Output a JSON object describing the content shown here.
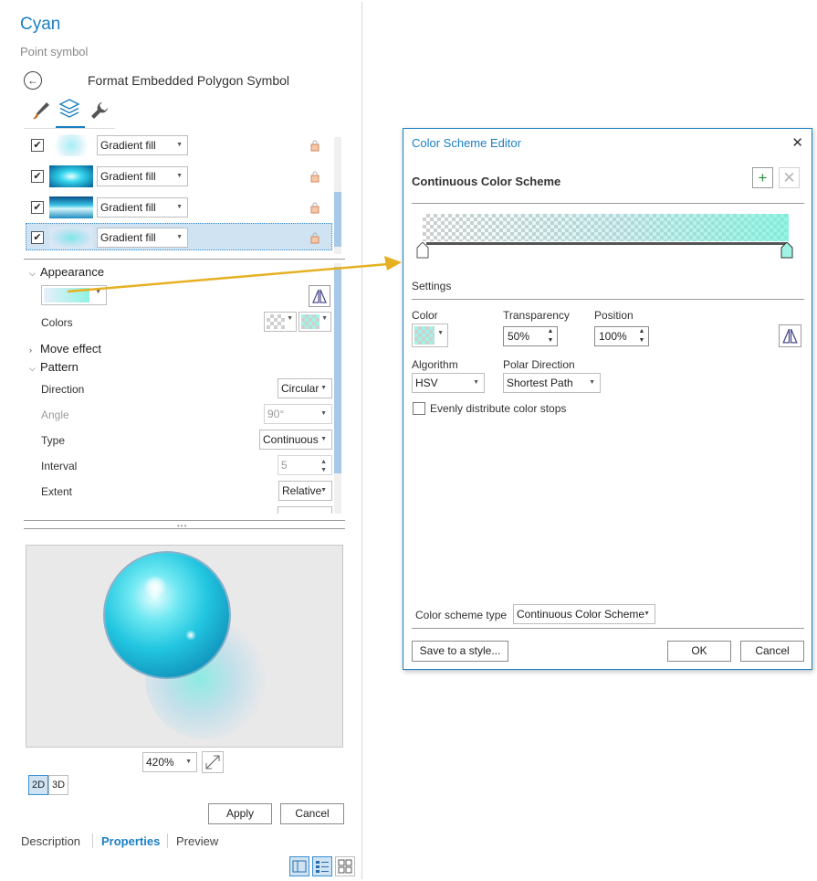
{
  "left_pane": {
    "title": "Cyan",
    "subtitle": "Point symbol",
    "pane_title": "Format Embedded Polygon Symbol",
    "tabs": [
      "brush-icon",
      "layers-icon",
      "wrench-icon"
    ],
    "layers": [
      {
        "checked": true,
        "fill": "Gradient fill"
      },
      {
        "checked": true,
        "fill": "Gradient fill"
      },
      {
        "checked": true,
        "fill": "Gradient fill"
      },
      {
        "checked": true,
        "fill": "Gradient fill",
        "selected": true
      }
    ],
    "appearance": {
      "heading": "Appearance",
      "colors_label": "Colors"
    },
    "move_effect": "Move effect",
    "pattern": {
      "heading": "Pattern",
      "direction_label": "Direction",
      "direction_value": "Circular",
      "angle_label": "Angle",
      "angle_value": "90°",
      "type_label": "Type",
      "type_value": "Continuous",
      "interval_label": "Interval",
      "interval_value": "5",
      "extent_label": "Extent",
      "extent_value": "Relative"
    },
    "zoom": "420%",
    "view_2d": "2D",
    "view_3d": "3D",
    "apply": "Apply",
    "cancel": "Cancel",
    "bottom_tabs": [
      "Description",
      "Properties",
      "Preview"
    ],
    "active_bottom_tab": "Properties"
  },
  "dialog": {
    "title": "Color Scheme Editor",
    "close": "✕",
    "heading": "Continuous Color Scheme",
    "settings_label": "Settings",
    "color_label": "Color",
    "transparency_label": "Transparency",
    "transparency_value": "50%",
    "position_label": "Position",
    "position_value": "100%",
    "algorithm_label": "Algorithm",
    "algorithm_value": "HSV",
    "polar_label": "Polar Direction",
    "polar_value": "Shortest Path",
    "evenly_label": "Evenly distribute color stops",
    "scheme_type_label": "Color scheme type",
    "scheme_type_value": "Continuous Color Scheme",
    "save_button": "Save to a style...",
    "ok_button": "OK",
    "cancel_button": "Cancel",
    "colors": {
      "accent": "#1a7fc4",
      "gradient_end": "#7ff3df"
    }
  }
}
